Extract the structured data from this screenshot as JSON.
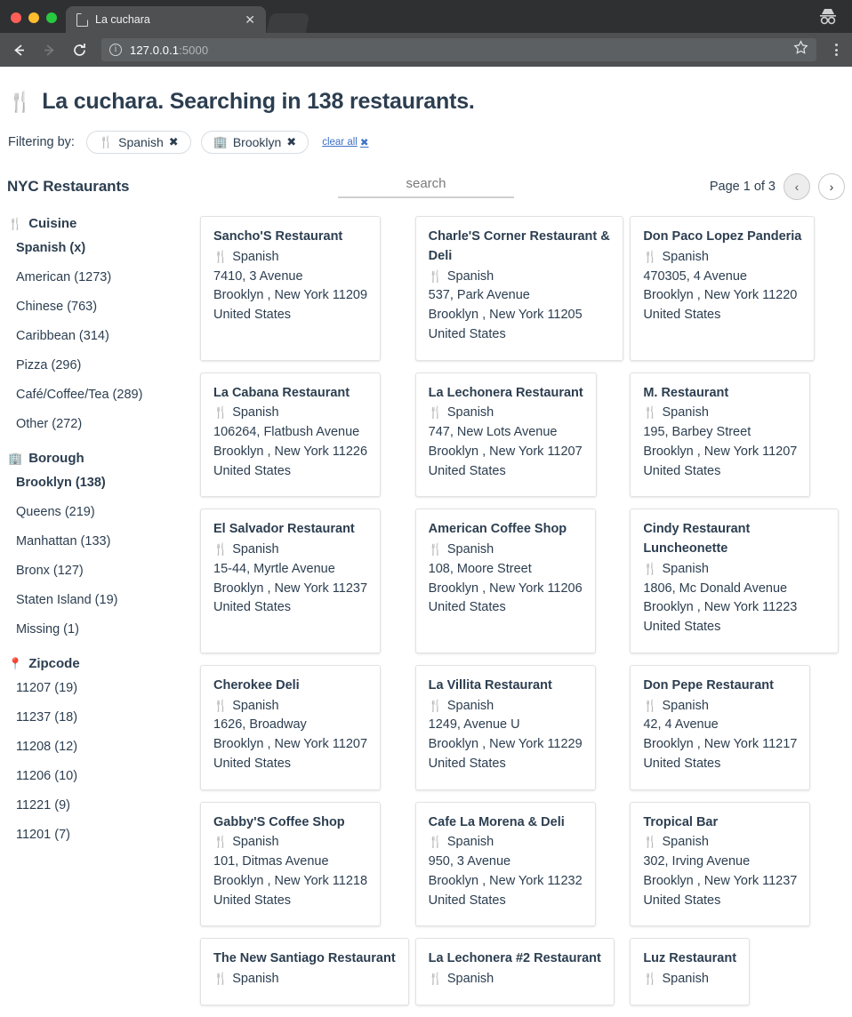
{
  "browser": {
    "tab_title": "La cuchara",
    "tab_close": "✕",
    "url_host": "127.0.0.1",
    "url_port": ":5000",
    "info_icon": "i",
    "back_icon": "←",
    "forward_icon": "→",
    "reload_icon": "⟳",
    "star_icon": "☆",
    "incognito_icon": "incognito-icon",
    "menu_icon": "kebab-menu-icon"
  },
  "header": {
    "icon": "🍴",
    "title": "La cuchara. Searching in 138 restaurants."
  },
  "filters": {
    "label": "Filtering by:",
    "pills": [
      {
        "icon": "🍴",
        "label": "Spanish",
        "close": "✖"
      },
      {
        "icon": "🏢",
        "label": "Brooklyn",
        "close": "✖"
      }
    ],
    "clear_all": "clear all",
    "clear_all_icon": "✖"
  },
  "subbar": {
    "title": "NYC Restaurants",
    "search_placeholder": "search",
    "search_value": "",
    "page_label": "Page 1 of 3",
    "prev_icon": "‹",
    "next_icon": "›"
  },
  "facets": [
    {
      "icon": "🍴",
      "title": "Cuisine",
      "items": [
        {
          "label": "Spanish (x)",
          "selected": true
        },
        {
          "label": "American (1273)",
          "selected": false
        },
        {
          "label": "Chinese (763)",
          "selected": false
        },
        {
          "label": "Caribbean (314)",
          "selected": false
        },
        {
          "label": "Pizza (296)",
          "selected": false
        },
        {
          "label": "Café/Coffee/Tea (289)",
          "selected": false
        },
        {
          "label": "Other (272)",
          "selected": false
        }
      ]
    },
    {
      "icon": "🏢",
      "title": "Borough",
      "items": [
        {
          "label": "Brooklyn (138)",
          "selected": true
        },
        {
          "label": "Queens (219)",
          "selected": false
        },
        {
          "label": "Manhattan (133)",
          "selected": false
        },
        {
          "label": "Bronx (127)",
          "selected": false
        },
        {
          "label": "Staten Island (19)",
          "selected": false
        },
        {
          "label": "Missing (1)",
          "selected": false
        }
      ]
    },
    {
      "icon": "📍",
      "title": "Zipcode",
      "items": [
        {
          "label": "11207 (19)",
          "selected": false
        },
        {
          "label": "11237 (18)",
          "selected": false
        },
        {
          "label": "11208 (12)",
          "selected": false
        },
        {
          "label": "11206 (10)",
          "selected": false
        },
        {
          "label": "11221 (9)",
          "selected": false
        },
        {
          "label": "11201 (7)",
          "selected": false
        }
      ]
    }
  ],
  "cuisine_glyph": "🍴",
  "restaurants": [
    {
      "name": "Sancho'S Restaurant",
      "cuisine": "Spanish",
      "street": "7410, 3 Avenue",
      "city": "Brooklyn , New York 11209",
      "country": "United States"
    },
    {
      "name": "Charle'S Corner Restaurant & Deli",
      "cuisine": "Spanish",
      "street": "537, Park Avenue",
      "city": "Brooklyn , New York 11205",
      "country": "United States"
    },
    {
      "name": "Don Paco Lopez Panderia",
      "cuisine": "Spanish",
      "street": "470305, 4 Avenue",
      "city": "Brooklyn , New York 11220",
      "country": "United States"
    },
    {
      "name": "La Cabana Restaurant",
      "cuisine": "Spanish",
      "street": "106264, Flatbush Avenue",
      "city": "Brooklyn , New York 11226",
      "country": "United States"
    },
    {
      "name": "La Lechonera Restaurant",
      "cuisine": "Spanish",
      "street": "747, New Lots Avenue",
      "city": "Brooklyn , New York 11207",
      "country": "United States"
    },
    {
      "name": "M. Restaurant",
      "cuisine": "Spanish",
      "street": "195, Barbey Street",
      "city": "Brooklyn , New York 11207",
      "country": "United States"
    },
    {
      "name": "El Salvador Restaurant",
      "cuisine": "Spanish",
      "street": "15-44, Myrtle Avenue",
      "city": "Brooklyn , New York 11237",
      "country": "United States"
    },
    {
      "name": "American Coffee Shop",
      "cuisine": "Spanish",
      "street": "108, Moore Street",
      "city": "Brooklyn , New York 11206",
      "country": "United States"
    },
    {
      "name": "Cindy Restaurant Luncheonette",
      "cuisine": "Spanish",
      "street": "1806, Mc Donald Avenue",
      "city": "Brooklyn , New York 11223",
      "country": "United States"
    },
    {
      "name": "Cherokee Deli",
      "cuisine": "Spanish",
      "street": "1626, Broadway",
      "city": "Brooklyn , New York 11207",
      "country": "United States"
    },
    {
      "name": "La Villita Restaurant",
      "cuisine": "Spanish",
      "street": "1249, Avenue U",
      "city": "Brooklyn , New York 11229",
      "country": "United States"
    },
    {
      "name": "Don Pepe Restaurant",
      "cuisine": "Spanish",
      "street": "42, 4 Avenue",
      "city": "Brooklyn , New York 11217",
      "country": "United States"
    },
    {
      "name": "Gabby'S Coffee Shop",
      "cuisine": "Spanish",
      "street": "101, Ditmas Avenue",
      "city": "Brooklyn , New York 11218",
      "country": "United States"
    },
    {
      "name": "Cafe La Morena & Deli",
      "cuisine": "Spanish",
      "street": "950, 3 Avenue",
      "city": "Brooklyn , New York 11232",
      "country": "United States"
    },
    {
      "name": "Tropical Bar",
      "cuisine": "Spanish",
      "street": "302, Irving Avenue",
      "city": "Brooklyn , New York 11237",
      "country": "United States"
    },
    {
      "name": "The New Santiago Restaurant",
      "cuisine": "Spanish",
      "street": "",
      "city": "",
      "country": ""
    },
    {
      "name": "La Lechonera #2 Restaurant",
      "cuisine": "Spanish",
      "street": "",
      "city": "",
      "country": ""
    },
    {
      "name": "Luz Restaurant",
      "cuisine": "Spanish",
      "street": "",
      "city": "",
      "country": ""
    }
  ],
  "colors": {
    "text": "#2c3e50",
    "link": "#3f72c9",
    "chrome_dark": "#2f3032",
    "chrome_toolbar": "#4e5052"
  }
}
